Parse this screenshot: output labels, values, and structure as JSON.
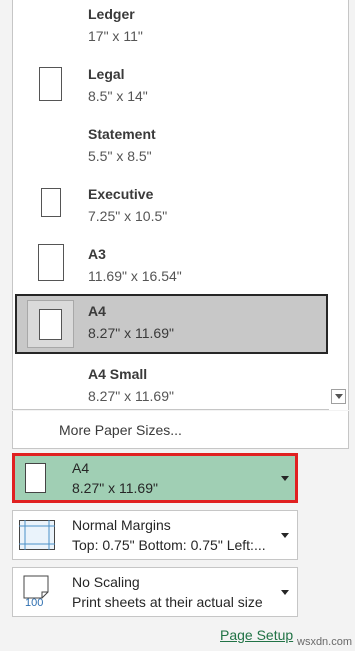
{
  "paper_sizes": [
    {
      "name": "Ledger",
      "size": "17\" x 11\""
    },
    {
      "name": "Legal",
      "size": "8.5\" x 14\""
    },
    {
      "name": "Statement",
      "size": "5.5\" x 8.5\""
    },
    {
      "name": "Executive",
      "size": "7.25\" x 10.5\""
    },
    {
      "name": "A3",
      "size": "11.69\" x 16.54\""
    },
    {
      "name": "A4",
      "size": "8.27\" x 11.69\"",
      "selected": true
    },
    {
      "name": "A4 Small",
      "size": "8.27\" x 11.69\""
    }
  ],
  "more_paper_sizes": "More Paper Sizes...",
  "paper_setting": {
    "title": "A4",
    "subtitle": "8.27\" x 11.69\""
  },
  "margins_setting": {
    "title": "Normal Margins",
    "subtitle": "Top: 0.75\" Bottom: 0.75\" Left:..."
  },
  "scaling_setting": {
    "title": "No Scaling",
    "subtitle": "Print sheets at their actual size",
    "icon_text": "100"
  },
  "page_setup_link": "Page Setup",
  "watermark": "wsxdn.com",
  "colors": {
    "highlight_fill": "#a0cfb4",
    "highlight_border": "#e02020",
    "selected_fill": "#c8c8c8",
    "link": "#217346"
  }
}
